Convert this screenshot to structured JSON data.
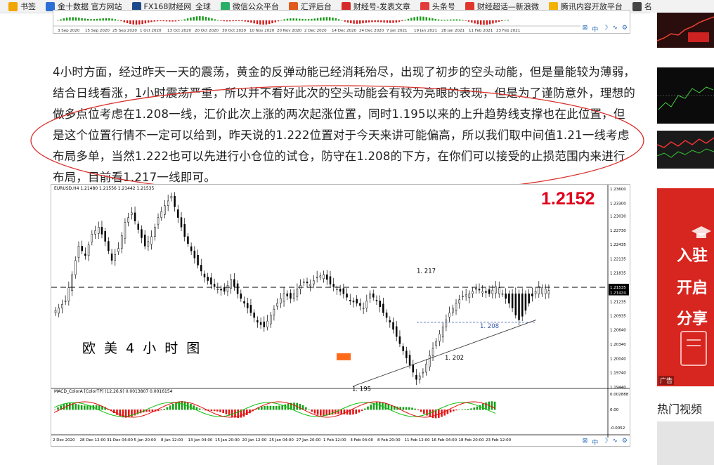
{
  "bookmarks": [
    {
      "label": "书签",
      "icon": "star-icon",
      "color": "#f0a500"
    },
    {
      "label": "金十数据 官方网站",
      "icon": "jin10-icon",
      "color": "#2b6fd6"
    },
    {
      "label": "FX168财经网_全球",
      "icon": "fx168-icon",
      "color": "#1b4a8c"
    },
    {
      "label": "微信公众平台",
      "icon": "wechat-icon",
      "color": "#2aae67"
    },
    {
      "label": "汇评后台",
      "icon": "huiping-icon",
      "color": "#e05a1c"
    },
    {
      "label": "财经号-发表文章",
      "icon": "caijinghao-icon",
      "color": "#d62b2b"
    },
    {
      "label": "头条号",
      "icon": "toutiao-icon",
      "color": "#e33b3b"
    },
    {
      "label": "财经超话—新浪微",
      "icon": "weibo-icon",
      "color": "#e0352b"
    },
    {
      "label": "腾讯内容开放平台",
      "icon": "tencent-icon",
      "color": "#f2b200"
    },
    {
      "label": "名",
      "icon": "ming-icon",
      "color": "#444444"
    }
  ],
  "top_chart": {
    "dates": [
      "3 Sep 2020",
      "15 Sep 2020",
      "25 Sep 2020",
      "1 Oct 2020",
      "13 Oct 2020",
      "20 Oct 2020",
      "30 Oct 2020",
      "10 Nov 2020",
      "20 Nov 2020",
      "2 Dec 2020",
      "14 Dec 2020",
      "24 Dec 2020",
      "7 Jan 2021",
      "19 Jan 2021",
      "28 Jan 2021",
      "11 Feb 2021",
      "23 Feb 2021"
    ],
    "tools": [
      "⊠",
      "中",
      "☽",
      "∿",
      "⚙"
    ]
  },
  "article": {
    "paragraph": "4小时方面，经过昨天一天的震荡，黄金的反弹动能已经消耗殆尽，出现了初步的空头动能，但是量能较为薄弱，结合日线看涨，1小时震荡严重，所以并不看好此次的空头动能会有较为亮眼的表现，但是为了谨防意外，理想的做多点位考虑在1.208一线，汇价此次上涨的两次起涨位置，同时1.195以来的上升趋势线支撑也在此位置，但是这个位置行情不一定可以给到，昨天说的1.222位置对于今天来讲可能偏高，所以我们取中间值1.21一线考虑布局多单，当然1.222也可以先进行小仓位的试仓，防守在1.208的下方，在你们可以接受的止损范围内来进行布局，目前看1.217一线即可。"
  },
  "main_chart": {
    "header": "EURUSD,H4 1.21480 1.21556 1.21442 1.21535",
    "big_price": "1.2152",
    "big_price_color": "#e0001b",
    "title_cn": "欧 美 4 小 时 图",
    "annotations": {
      "high": "1. 217",
      "support": "1. 208",
      "low2": "1. 202",
      "low1": "1. 195"
    },
    "price_labels": [
      "1.23600",
      "1.23300",
      "1.23030",
      "1.22730",
      "1.22435",
      "1.22135",
      "1.21835",
      "1.21535",
      "1.21424",
      "1.21235",
      "1.20935",
      "1.20640",
      "1.20340",
      "1.20040",
      "1.19740",
      "1.19440"
    ],
    "current_price": "1.21535",
    "ask_price": "1.21424",
    "macd_header": "MACD_ColorA  [ColorTP] (12,26,9) 0.0013807 0.0016154",
    "macd_labels": [
      "0.002888",
      "0.00",
      "-0.0052"
    ],
    "time_labels": [
      "2 Dec 2020",
      "28 Dec 12:00",
      "31 Dec 04:00",
      "5 Jan 20:00",
      "8 Jan 12:00",
      "13 Jan 04:00",
      "15 Jan 20:00",
      "20 Jan 12:00",
      "25 Jan 04:00",
      "27 Jan 20:00",
      "1 Feb 12:00",
      "4 Feb 04:00",
      "8 Feb 20:00",
      "11 Feb 12:00",
      "16 Feb 04:00",
      "18 Feb 20:00",
      "23 Feb 12:00"
    ],
    "tools": [
      "⊠",
      "中",
      "☽",
      "∿",
      "⚙"
    ]
  },
  "chart_data": {
    "type": "candlestick",
    "title": "欧 美 4 小 时 图",
    "symbol": "EURUSD,H4",
    "ylim": [
      1.1944,
      1.236
    ],
    "close": [
      1.211,
      1.2125,
      1.218,
      1.224,
      1.222,
      1.2265,
      1.228,
      1.225,
      1.221,
      1.2235,
      1.229,
      1.231,
      1.2275,
      1.224,
      1.226,
      1.23,
      1.2325,
      1.2345,
      1.23,
      1.226,
      1.223,
      1.22,
      1.2175,
      1.216,
      1.215,
      1.2145,
      1.217,
      1.214,
      1.212,
      1.21,
      1.208,
      1.207,
      1.2095,
      1.212,
      1.214,
      1.213,
      1.215,
      1.2165,
      1.216,
      1.2175,
      1.218,
      1.216,
      1.215,
      1.214,
      1.2125,
      1.212,
      1.211,
      1.214,
      1.2125,
      1.21,
      1.208,
      1.205,
      1.202,
      1.199,
      1.196,
      1.1975,
      1.201,
      1.204,
      1.207,
      1.21,
      1.212,
      1.2135,
      1.214,
      1.215,
      1.2145,
      1.214,
      1.2155,
      1.2165,
      1.214,
      1.212,
      1.21,
      1.208,
      1.205,
      1.203,
      1.2045,
      1.207,
      1.21,
      1.213,
      1.215,
      1.217,
      1.2165,
      1.216,
      1.2153
    ],
    "support_line": 1.208,
    "current": 1.21535,
    "ask": 1.21424
  },
  "sidebar": {
    "promo_lines": [
      "入驻",
      "开启",
      "分享"
    ],
    "promo_tag": "广告",
    "hot_title": "热门视频"
  }
}
